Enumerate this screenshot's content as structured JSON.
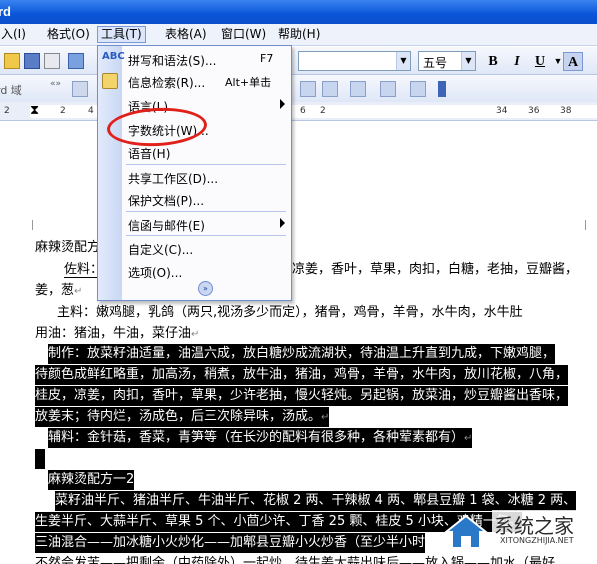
{
  "window": {
    "title": "rd"
  },
  "menubar": {
    "items": [
      {
        "label": "入(I)"
      },
      {
        "label": "格式(O)"
      },
      {
        "label": "工具(T)"
      },
      {
        "label": "表格(A)"
      },
      {
        "label": "窗口(W)"
      },
      {
        "label": "帮助(H)"
      }
    ]
  },
  "toolbar": {
    "font_size": "五号",
    "bold": "B",
    "italic": "I",
    "underline": "U",
    "font_color": "A",
    "field_label": "rd 域",
    "insert_label": "«»",
    "ruler_ticks": [
      "2",
      "2",
      "4",
      "6",
      "2",
      "34",
      "36",
      "38"
    ]
  },
  "tools_menu": {
    "items": [
      {
        "label": "拼写和语法(S)...",
        "shortcut": "F7",
        "icon": "spelling-icon"
      },
      {
        "label": "信息检索(R)...",
        "shortcut": "Alt+单击",
        "icon": "research-icon"
      },
      {
        "label": "语言(L)",
        "submenu": true
      },
      {
        "label": "字数统计(W)..."
      },
      {
        "label": "语音(H)"
      },
      {
        "label": "共享工作区(D)..."
      },
      {
        "label": "保护文档(P)..."
      },
      {
        "label": "信函与邮件(E)",
        "submenu": true
      },
      {
        "label": "自定义(C)..."
      },
      {
        "label": "选项(O)..."
      }
    ],
    "more": "»"
  },
  "document": {
    "lines": [
      {
        "text": "麻辣烫配方",
        "tail": "",
        "highlight": false
      },
      {
        "text": "佐料：",
        "tail": "凉姜，香叶，草果，肉扣，白糖，老抽，豆瓣酱，",
        "highlight": false
      },
      {
        "text": "姜，葱",
        "highlight": false
      },
      {
        "text": "主料：嫩鸡腿，乳鸽（两只,视汤多少而定），猪骨，鸡骨，羊骨，水牛肉，水牛肚",
        "highlight": false
      },
      {
        "text": "用油：猪油，牛油，菜仔油",
        "highlight": false
      },
      {
        "text": "制作：放菜籽油适量，油温六成，放白糖炒成流湖状，待油温上升直到九成，下嫩鸡腿，",
        "highlight": true
      },
      {
        "text": "待颜色成鲜红略重，加高汤，稍煮，放牛油，猪油，鸡骨，羊骨，水牛肉，放川花椒，八角，",
        "highlight": true
      },
      {
        "text": "桂皮，凉姜，肉扣，香叶，草果，少许老抽，慢火轻炖。另起锅，放菜油，炒豆瓣酱出香味，",
        "highlight": true
      },
      {
        "text": "放姜末；待内烂，汤成色，后三次除异味，汤成。",
        "highlight": true
      },
      {
        "text": "辅料：金针菇，香菜，青笋等（在长沙的配料有很多种，各种荤素都有）",
        "highlight": true
      },
      {
        "text": "",
        "highlight": true
      },
      {
        "text": "麻辣烫配方一2",
        "highlight": true
      },
      {
        "text": "菜籽油半斤、猪油半斤、牛油半斤、花椒 2 两、干辣椒 4 两、郫县豆瓣 1 袋、冰糖 2 两、",
        "highlight": true
      },
      {
        "text": "生姜半斤、大蒜半斤、草果 5 个、小茴少许、丁香 25 颗、桂皮 5 小块、鸡精一包。",
        "highlight": true
      },
      {
        "text": "三油混合——加冰糖小火炒化——加郫县豆瓣小火炒香（至少半小时",
        "highlight": true
      },
      {
        "text": "不然会发苦——把剩余（中药除外）一起炒，待生姜大蒜出味后——放入锅——加水（最好",
        "highlight": false
      }
    ]
  },
  "watermark": {
    "text": "系统之家",
    "sub": "XITONGZHIJIA.NET"
  },
  "colors": {
    "title_bar": "#0a55d8",
    "highlight_bg": "#000000",
    "annotation_circle": "#e0201a"
  }
}
